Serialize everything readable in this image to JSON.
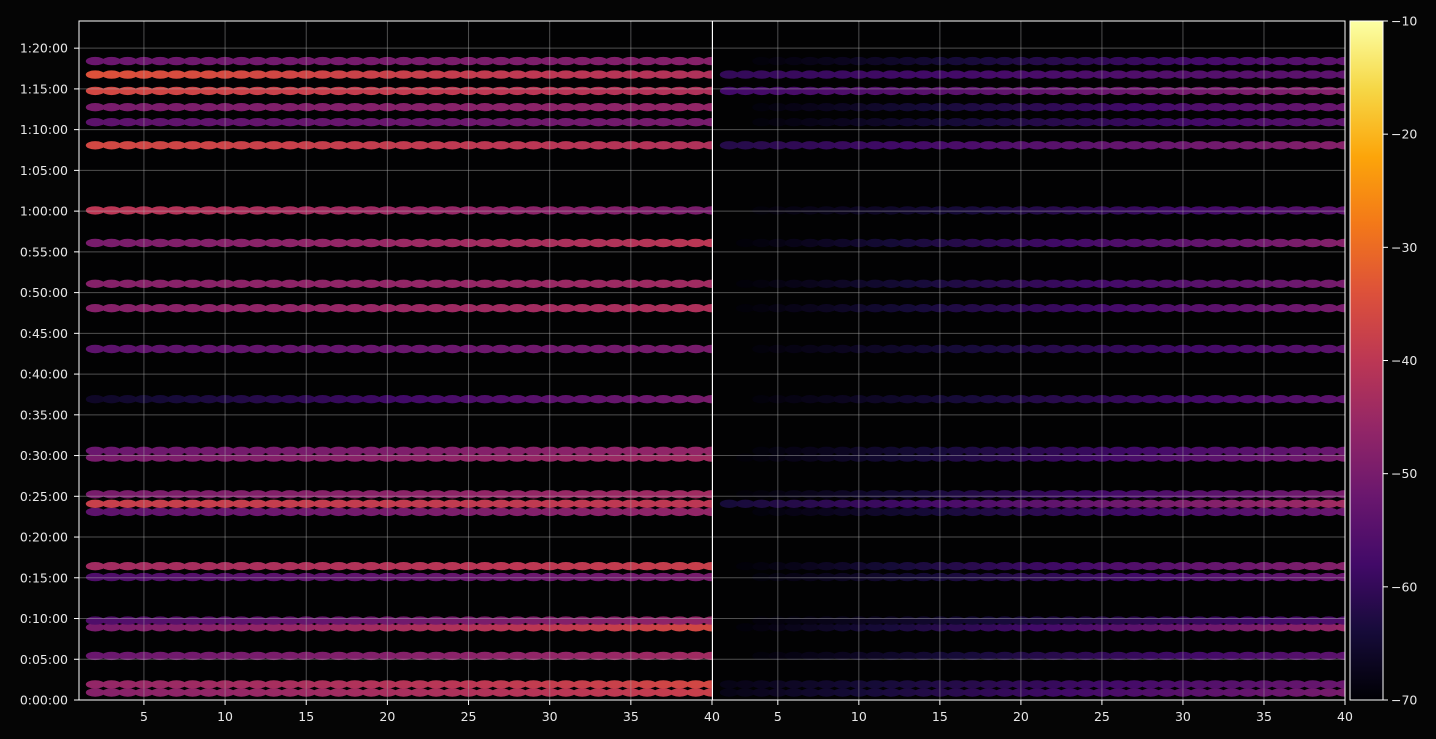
{
  "chart_data": {
    "type": "heatmap",
    "title": "",
    "xlabel": "",
    "ylabel": "",
    "colorscale": "inferno",
    "panels": [
      {
        "name": "panel-left",
        "xlim": [
          1,
          40
        ],
        "xticks": [
          5,
          10,
          15,
          20,
          25,
          30,
          35,
          40
        ],
        "xtick_labels": [
          "5",
          "10",
          "15",
          "20",
          "25",
          "30",
          "35",
          "40"
        ],
        "channels": [
          2,
          40
        ]
      },
      {
        "name": "panel-right",
        "xlim": [
          1,
          40
        ],
        "xticks": [
          5,
          10,
          15,
          20,
          25,
          30,
          35,
          40
        ],
        "xtick_labels": [
          "5",
          "10",
          "15",
          "20",
          "25",
          "30",
          "35",
          "40"
        ],
        "channels": [
          2,
          40
        ]
      }
    ],
    "y": {
      "unit": "time",
      "lim": [
        "0:00:00",
        "1:23:20"
      ],
      "ticks": [
        "0:00:00",
        "0:05:00",
        "0:10:00",
        "0:15:00",
        "0:20:00",
        "0:25:00",
        "0:30:00",
        "0:35:00",
        "0:40:00",
        "0:45:00",
        "0:50:00",
        "0:55:00",
        "1:00:00",
        "1:05:00",
        "1:10:00",
        "1:15:00",
        "1:20:00"
      ]
    },
    "colorbar": {
      "lim": [
        -70,
        -10
      ],
      "ticks": [
        -10,
        -20,
        -30,
        -40,
        -50,
        -60,
        -70
      ],
      "tick_labels": [
        "−10",
        "−20",
        "−30",
        "−40",
        "−50",
        "−60",
        "−70"
      ]
    },
    "grid": true,
    "rows": [
      {
        "t": "0:00:55",
        "left": [
          -48,
          -38
        ],
        "right": [
          -68,
          -50
        ]
      },
      {
        "t": "0:01:55",
        "left": [
          -46,
          -36
        ],
        "right": [
          -68,
          -52
        ]
      },
      {
        "t": "0:05:25",
        "left": [
          -52,
          -44
        ],
        "right": [
          -70,
          -54
        ]
      },
      {
        "t": "0:08:55",
        "left": [
          -50,
          -36
        ],
        "right": [
          -70,
          -46
        ]
      },
      {
        "t": "0:09:45",
        "left": [
          -56,
          -46
        ],
        "right": [
          -70,
          -56
        ]
      },
      {
        "t": "0:15:05",
        "left": [
          -56,
          -50
        ],
        "right": [
          -70,
          -52
        ]
      },
      {
        "t": "0:16:25",
        "left": [
          -44,
          -38
        ],
        "right": [
          -70,
          -48
        ]
      },
      {
        "t": "0:23:05",
        "left": [
          -54,
          -46
        ],
        "right": [
          -70,
          -52
        ]
      },
      {
        "t": "0:24:05",
        "left": [
          -38,
          -40
        ],
        "right": [
          -64,
          -44
        ]
      },
      {
        "t": "0:25:15",
        "left": [
          -50,
          -44
        ],
        "right": [
          -70,
          -50
        ]
      },
      {
        "t": "0:29:45",
        "left": [
          -50,
          -44
        ],
        "right": [
          -70,
          -50
        ]
      },
      {
        "t": "0:30:35",
        "left": [
          -52,
          -46
        ],
        "right": [
          -70,
          -52
        ]
      },
      {
        "t": "0:36:55",
        "left": [
          -66,
          -50
        ],
        "right": [
          -70,
          -54
        ]
      },
      {
        "t": "0:43:05",
        "left": [
          -54,
          -50
        ],
        "right": [
          -70,
          -54
        ]
      },
      {
        "t": "0:48:05",
        "left": [
          -48,
          -42
        ],
        "right": [
          -70,
          -50
        ]
      },
      {
        "t": "0:51:05",
        "left": [
          -48,
          -44
        ],
        "right": [
          -70,
          -50
        ]
      },
      {
        "t": "0:56:05",
        "left": [
          -50,
          -40
        ],
        "right": [
          -70,
          -48
        ]
      },
      {
        "t": "1:00:05",
        "left": [
          -40,
          -50
        ],
        "right": [
          -70,
          -54
        ]
      },
      {
        "t": "1:08:05",
        "left": [
          -36,
          -42
        ],
        "right": [
          -62,
          -48
        ]
      },
      {
        "t": "1:10:55",
        "left": [
          -54,
          -50
        ],
        "right": [
          -70,
          -54
        ]
      },
      {
        "t": "1:12:45",
        "left": [
          -50,
          -46
        ],
        "right": [
          -70,
          -52
        ]
      },
      {
        "t": "1:14:45",
        "left": [
          -36,
          -42
        ],
        "right": [
          -58,
          -48
        ]
      },
      {
        "t": "1:16:45",
        "left": [
          -34,
          -42
        ],
        "right": [
          -60,
          -54
        ]
      },
      {
        "t": "1:18:25",
        "left": [
          -52,
          -48
        ],
        "right": [
          -70,
          -54
        ]
      }
    ]
  }
}
